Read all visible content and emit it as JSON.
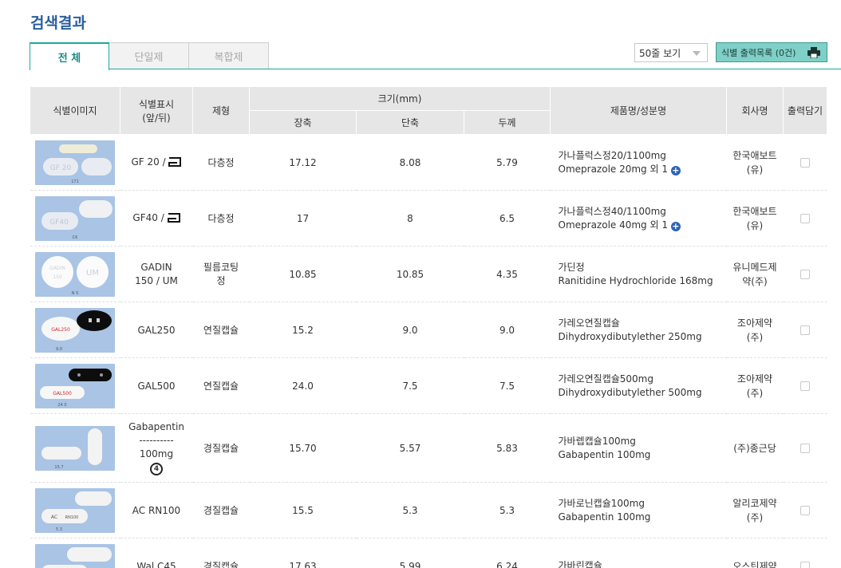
{
  "page": {
    "title": "검색결과"
  },
  "tabs": [
    {
      "label": "전 체",
      "active": true
    },
    {
      "label": "단일제",
      "active": false
    },
    {
      "label": "복합제",
      "active": false
    }
  ],
  "controls": {
    "rows_select": "50줄 보기",
    "print_button": "식별 출력목록 (0건)",
    "print_icon": "printer-icon"
  },
  "table": {
    "headers": {
      "image": "식별이미지",
      "mark_line1": "식별표시",
      "mark_line2": "(앞/뒤)",
      "form": "제형",
      "size": "크기(mm)",
      "long": "장축",
      "short": "단축",
      "thick": "두께",
      "product": "제품명/성분명",
      "company": "회사명",
      "print": "출력담기"
    },
    "rows": [
      {
        "mark": "GF 20 /",
        "mark_logo": "abbott-logo",
        "form": "다층정",
        "long": "17.12",
        "short": "8.08",
        "thick": "5.79",
        "product": "가나플럭스정20/1100mg",
        "ingredient": "Omeprazole   20mg 외 1",
        "has_more": true,
        "more_icon": "plus-circle-icon",
        "company_1": "한국애보트",
        "company_2": "(유)"
      },
      {
        "mark": "GF40 /",
        "mark_logo": "abbott-logo",
        "form": "다층정",
        "long": "17",
        "short": "8",
        "thick": "6.5",
        "product": "가나플럭스정40/1100mg",
        "ingredient": "Omeprazole   40mg 외 1",
        "has_more": true,
        "more_icon": "plus-circle-icon",
        "company_1": "한국애보트",
        "company_2": "(유)"
      },
      {
        "mark_1": "GADIN",
        "mark_2": "150 / UM",
        "form_1": "필름코팅",
        "form_2": "정",
        "long": "10.85",
        "short": "10.85",
        "thick": "4.35",
        "product": "가딘정",
        "ingredient": "Ranitidine Hydrochloride   168mg",
        "company_1": "유니메드제",
        "company_2": "약(주)"
      },
      {
        "mark": "GAL250",
        "form": "연질캡슐",
        "long": "15.2",
        "short": "9.0",
        "thick": "9.0",
        "product": "가레오연질캡슐",
        "ingredient": "Dihydroxydibutylether   250mg",
        "company_1": "조아제약",
        "company_2": "(주)"
      },
      {
        "mark": "GAL500",
        "form": "연질캡슐",
        "long": "24.0",
        "short": "7.5",
        "thick": "7.5",
        "product": "가레오연질캡슐500mg",
        "ingredient": "Dihydroxydibutylether   500mg",
        "company_1": "조아제약",
        "company_2": "(주)"
      },
      {
        "mark_1": "Gabapentin",
        "mark_2": "----------",
        "mark_3": "100mg",
        "mark_logo_text": "4",
        "form": "경질캡슐",
        "long": "15.70",
        "short": "5.57",
        "thick": "5.83",
        "product": "가바렙캡슐100mg",
        "ingredient": "Gabapentin   100mg",
        "company_1": "(주)종근당"
      },
      {
        "mark": "AC RN100",
        "form": "경질캡슐",
        "long": "15.5",
        "short": "5.3",
        "thick": "5.3",
        "product": "가바로닌캡슐100mg",
        "ingredient": "Gabapentin   100mg",
        "company_1": "알리코제약",
        "company_2": "(주)"
      },
      {
        "mark": "Wal C45",
        "form": "경질캡슐",
        "long": "17.63",
        "short": "5.99",
        "thick": "6.24",
        "product": "가바린캡슐",
        "company_1": "오스틴제약"
      }
    ]
  },
  "pill_images": [
    {
      "imprint_front": "GF 20",
      "label": "171",
      "colors": [
        "#f1f1ea",
        "#e9e8d8"
      ]
    },
    {
      "imprint_front": "GF40",
      "label": "C6",
      "colors": [
        "#f1f1ea"
      ]
    },
    {
      "imprint_front": "GADIN 150",
      "imprint_back": "UM",
      "label": "N 5",
      "colors": [
        "#ffffff"
      ]
    },
    {
      "imprint_front": "GAL250",
      "label": "9.0",
      "colors": [
        "#f7f7f7",
        "#111111"
      ]
    },
    {
      "imprint_front": "GAL500",
      "label": "24 0",
      "colors": [
        "#f7f7f7",
        "#111111"
      ]
    },
    {
      "imprint_front": "",
      "label": "15.7",
      "colors": [
        "#f2f2f2"
      ]
    },
    {
      "imprint_front": "AC",
      "imprint_back": "RN100",
      "label": "5.3",
      "colors": [
        "#f2f2f2"
      ]
    },
    {
      "imprint_front": "",
      "colors": [
        "#f2f2f2"
      ]
    }
  ]
}
